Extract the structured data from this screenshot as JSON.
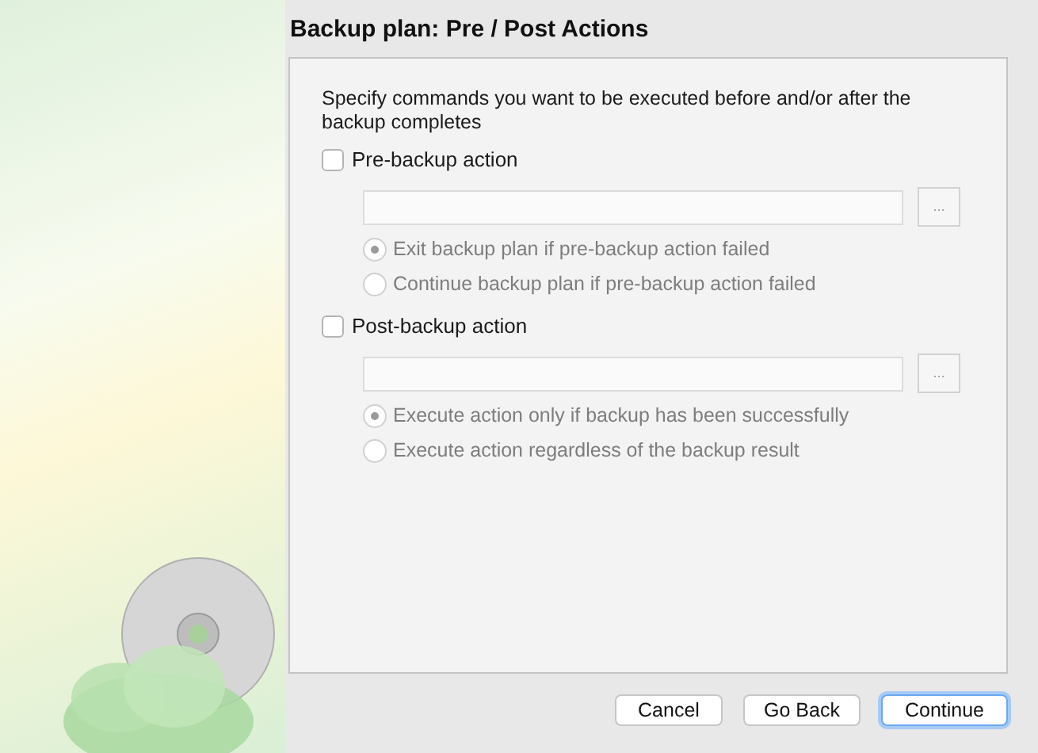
{
  "title": "Backup plan: Pre / Post Actions",
  "description": "Specify commands you want to be executed before and/or after the backup completes",
  "sections": [
    {
      "label": "Pre-backup action",
      "checked": false,
      "browse": "...",
      "options": [
        {
          "label": "Exit backup plan if pre-backup action failed",
          "selected": true
        },
        {
          "label": "Continue backup plan if pre-backup action failed",
          "selected": false
        }
      ]
    },
    {
      "label": "Post-backup action",
      "checked": false,
      "browse": "...",
      "options": [
        {
          "label": "Execute action only if backup has been successfully",
          "selected": true
        },
        {
          "label": "Execute action regardless of the backup result",
          "selected": false
        }
      ]
    }
  ],
  "buttons": [
    {
      "label": "Cancel",
      "default": false
    },
    {
      "label": "Go Back",
      "default": false
    },
    {
      "label": "Continue",
      "default": true
    }
  ]
}
